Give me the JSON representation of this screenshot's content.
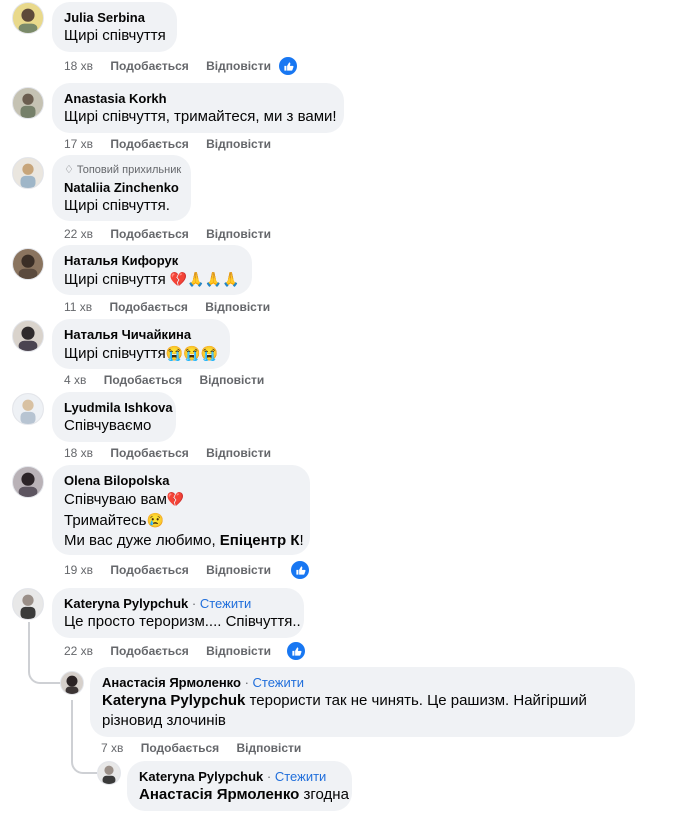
{
  "comments": [
    {
      "author": "Julia Serbina",
      "text": "Щирі співчуття",
      "time": "18 хв",
      "like": "Подобається",
      "reply": "Відповісти",
      "avatar_color": "#6b7f5e"
    },
    {
      "author": "Anastasia Korkh",
      "text": "Щирі співчуття, тримайтеся, ми з вами!",
      "time": "17 хв",
      "like": "Подобається",
      "reply": "Відповісти",
      "avatar_color": "#8a8f7a"
    },
    {
      "badge": "Топовий прихильник",
      "author": "Nataliia Zinchenko",
      "text": "Щирі співчуття.",
      "time": "22 хв",
      "like": "Подобається",
      "reply": "Відповісти",
      "avatar_color": "#a99a87"
    },
    {
      "author": "Наталья Кифорук",
      "text": "Щирі співчуття ",
      "emoji": "💔🙏🙏🙏",
      "time": "11 хв",
      "like": "Подобається",
      "reply": "Відповісти",
      "avatar_color": "#6e5a4c"
    },
    {
      "author": "Наталья Чичайкина",
      "text": "Щирі співчуття",
      "emoji": "😭😭😭",
      "time": "4 хв",
      "like": "Подобається",
      "reply": "Відповісти",
      "avatar_color": "#4e4a52"
    },
    {
      "author": "Lyudmila Ishkova",
      "text": "Співчуваємо",
      "time": "18 хв",
      "like": "Подобається",
      "reply": "Відповісти",
      "avatar_color": "#b8bfc7"
    },
    {
      "author": "Olena Bilopolska",
      "line1": "Співчуваю вам",
      "emoji1": "💔",
      "line2": "Тримайтесь",
      "emoji2": "😢",
      "line3_pre": "Ми вас дуже любимо, ",
      "line3_bold": "Епіцентр К",
      "line3_post": "!",
      "time": "19 хв",
      "like": "Подобається",
      "reply": "Відповісти",
      "avatar_color": "#5b5560"
    },
    {
      "author": "Kateryna Pylypchuk",
      "follow": "Стежити",
      "dot": " · ",
      "text": "Це просто тероризм.... Співчуття..",
      "time": "22 хв",
      "like": "Подобається",
      "reply": "Відповісти",
      "avatar_color": "#cfcfcf"
    }
  ],
  "replies": [
    {
      "author": "Анастасія Ярмоленко",
      "follow": "Стежити",
      "dot": " · ",
      "mention": "Kateryna Pylypchuk",
      "text_line1": " терористи так не чинять. Це рашизм. Найгірший",
      "text_line2": "різновид злочинів",
      "time": "7 хв",
      "like": "Подобається",
      "reply": "Відповісти",
      "avatar_color": "#3c3535"
    },
    {
      "author": "Kateryna Pylypchuk",
      "follow": "Стежити",
      "dot": " · ",
      "mention": "Анастасія Ярмоленко",
      "text": " згодна",
      "avatar_color": "#cfcfcf"
    }
  ]
}
